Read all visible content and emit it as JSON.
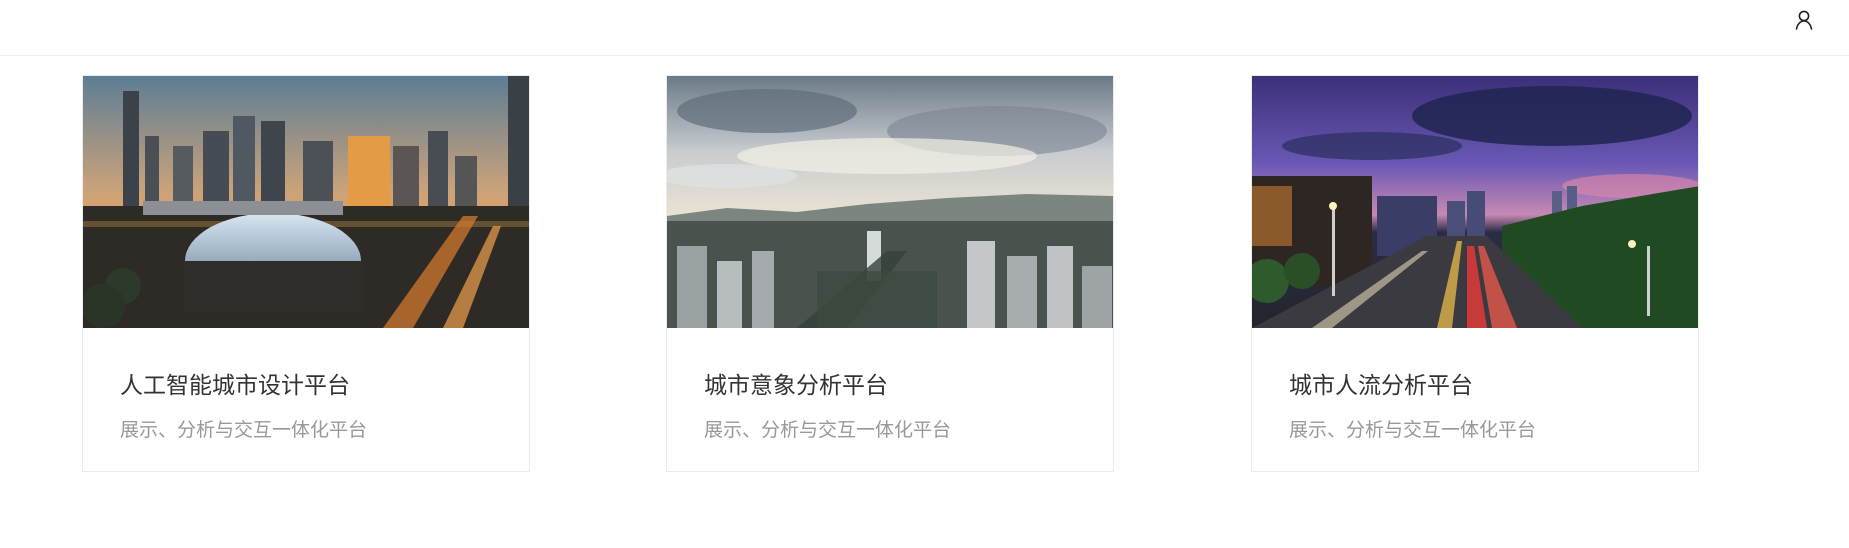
{
  "header": {
    "user_icon": "user-icon"
  },
  "cards": [
    {
      "title": "人工智能城市设计平台",
      "subtitle": "展示、分析与交互一体化平台",
      "image": "city-night-skyline-photo"
    },
    {
      "title": "城市意象分析平台",
      "subtitle": "展示、分析与交互一体化平台",
      "image": "city-aerial-cloudy-photo"
    },
    {
      "title": "城市人流分析平台",
      "subtitle": "展示、分析与交互一体化平台",
      "image": "city-road-dusk-photo"
    }
  ]
}
